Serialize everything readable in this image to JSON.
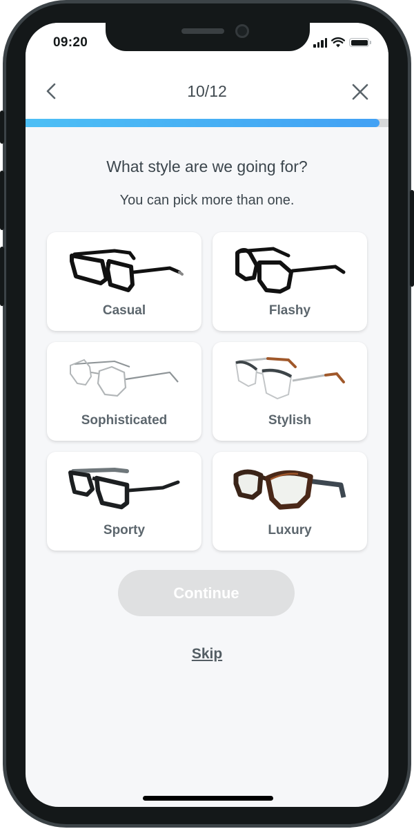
{
  "status_bar": {
    "time": "09:20",
    "icons": [
      "cellular-signal-icon",
      "wifi-icon",
      "battery-icon"
    ]
  },
  "nav": {
    "back_icon": "chevron-left-icon",
    "step_label": "10/12",
    "close_icon": "close-icon"
  },
  "progress": {
    "fraction": 0.975,
    "color_start": "#4dbff5",
    "color_end": "#42a1f4",
    "track_color": "#d6d8da"
  },
  "content": {
    "question": "What style are we going for?",
    "hint": "You can pick more than one."
  },
  "options": [
    {
      "label": "Casual",
      "image": "black-rectangular-glasses"
    },
    {
      "label": "Flashy",
      "image": "black-oversized-square-glasses"
    },
    {
      "label": "Sophisticated",
      "image": "silver-wire-hexagonal-glasses"
    },
    {
      "label": "Stylish",
      "image": "silver-tortoise-browline-glasses"
    },
    {
      "label": "Sporty",
      "image": "black-grey-sport-glasses"
    },
    {
      "label": "Luxury",
      "image": "tortoise-cat-eye-glasses"
    }
  ],
  "actions": {
    "continue_label": "Continue",
    "continue_enabled": false,
    "skip_label": "Skip"
  }
}
